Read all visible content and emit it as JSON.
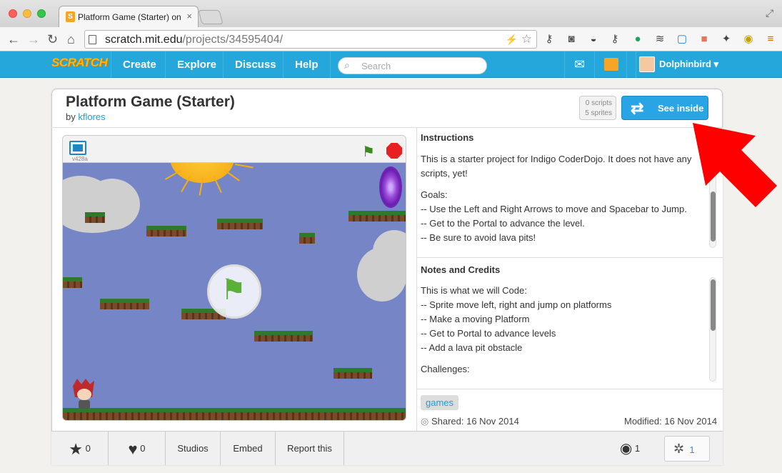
{
  "browser": {
    "tab_title": "Platform Game (Starter) on Scratch",
    "tab_close": "×",
    "url_host": "scratch.mit.edu",
    "url_path": "/projects/34595404/"
  },
  "site_nav": {
    "logo": "SCRATCH",
    "items": [
      "Create",
      "Explore",
      "Discuss",
      "Help"
    ],
    "search_placeholder": "Search",
    "username": "Dolphinbird ▾"
  },
  "project": {
    "title": "Platform Game (Starter)",
    "by_prefix": "by ",
    "author": "kflores",
    "scripts_count": "0 scripts",
    "sprites_count": "5 sprites",
    "see_inside_label": "See inside",
    "version": "v428a"
  },
  "instructions": {
    "heading": "Instructions",
    "paragraphs": [
      "This is a starter project for Indigo CoderDojo. It does not have any scripts, yet!",
      "Goals:",
      "-- Use the Left and Right Arrows to move and Spacebar to Jump.",
      "-- Get to the Portal to advance the level.",
      "-- Be sure to avoid lava pits!"
    ]
  },
  "notes": {
    "heading": "Notes and Credits",
    "lines": [
      "This is what we will Code:",
      "-- Sprite move left, right and jump on platforms",
      "-- Make a moving Platform",
      "-- Get to Portal to advance levels",
      "-- Add a lava pit obstacle"
    ],
    "challenges": "Challenges:"
  },
  "meta": {
    "tag": "games",
    "shared": "Shared: 16 Nov 2014",
    "modified": "Modified: 16 Nov 2014"
  },
  "actions": {
    "stars": "0",
    "loves": "0",
    "studios": "Studios",
    "embed": "Embed",
    "report": "Report this",
    "views": "1",
    "remixes": "1"
  },
  "colors": {
    "accent": "#25a7dc",
    "annotation_arrow": "#ff0000"
  }
}
